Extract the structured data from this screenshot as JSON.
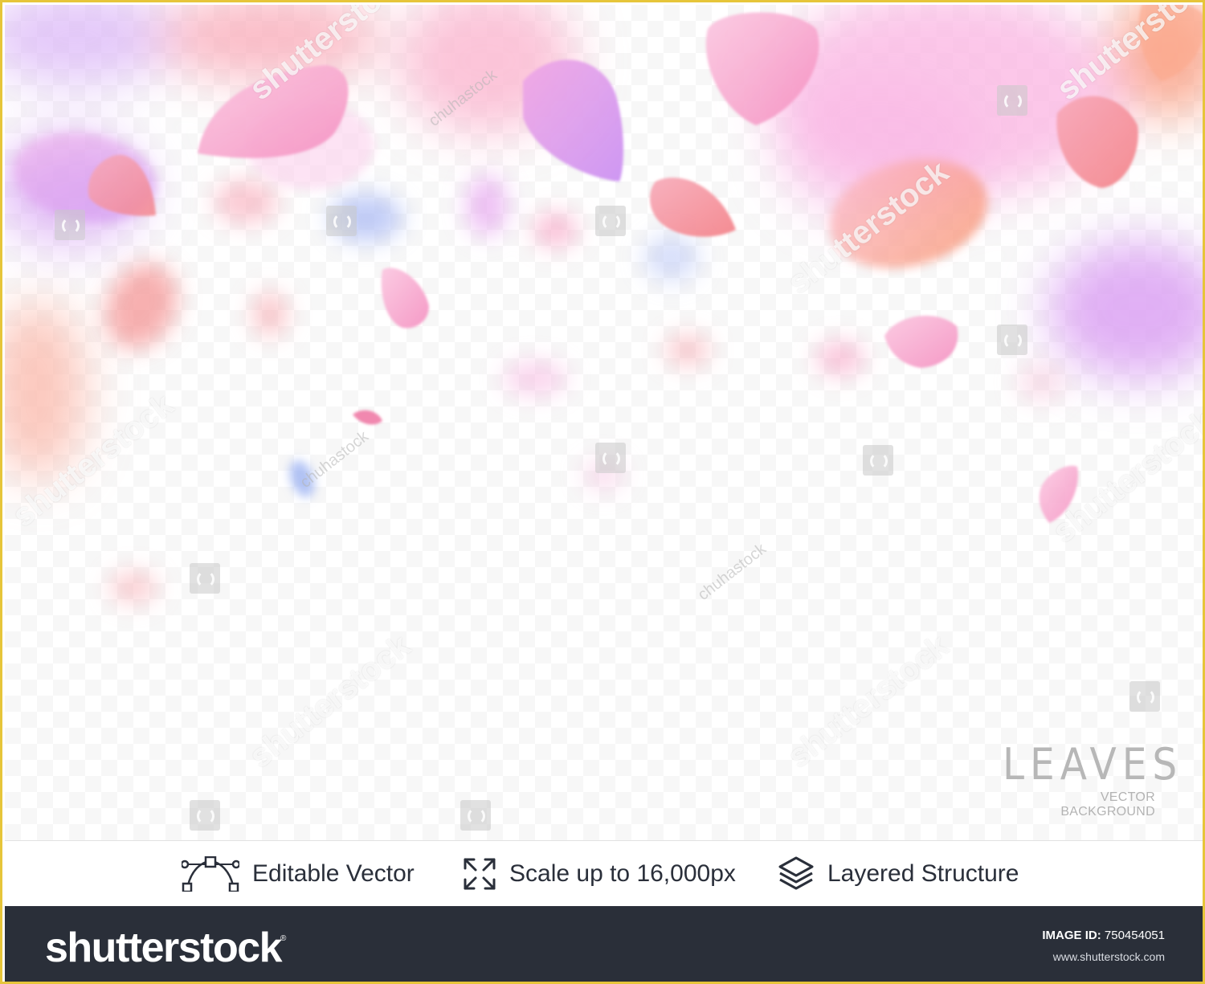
{
  "artwork": {
    "title": "LEAVES",
    "subtitle": "VECTOR BACKGROUND"
  },
  "watermarks": {
    "brand": "shutterstock",
    "contributor": "chuhastock"
  },
  "features": [
    {
      "icon": "vector-path-icon",
      "label": "Editable Vector"
    },
    {
      "icon": "scale-arrows-icon",
      "label": "Scale up to 16,000px"
    },
    {
      "icon": "layers-icon",
      "label": "Layered Structure"
    }
  ],
  "footer": {
    "logo": "shutterstock",
    "image_id_label": "IMAGE ID:",
    "image_id_value": "750454051",
    "site": "www.shutterstock.com"
  },
  "colors": {
    "frame_border": "#e6c53a",
    "footer_bg": "#2a2f39",
    "petal_pink": "#f6a6c8",
    "petal_coral": "#f48f8f",
    "petal_violet": "#d59cf0",
    "petal_blue": "#aebcf4"
  }
}
